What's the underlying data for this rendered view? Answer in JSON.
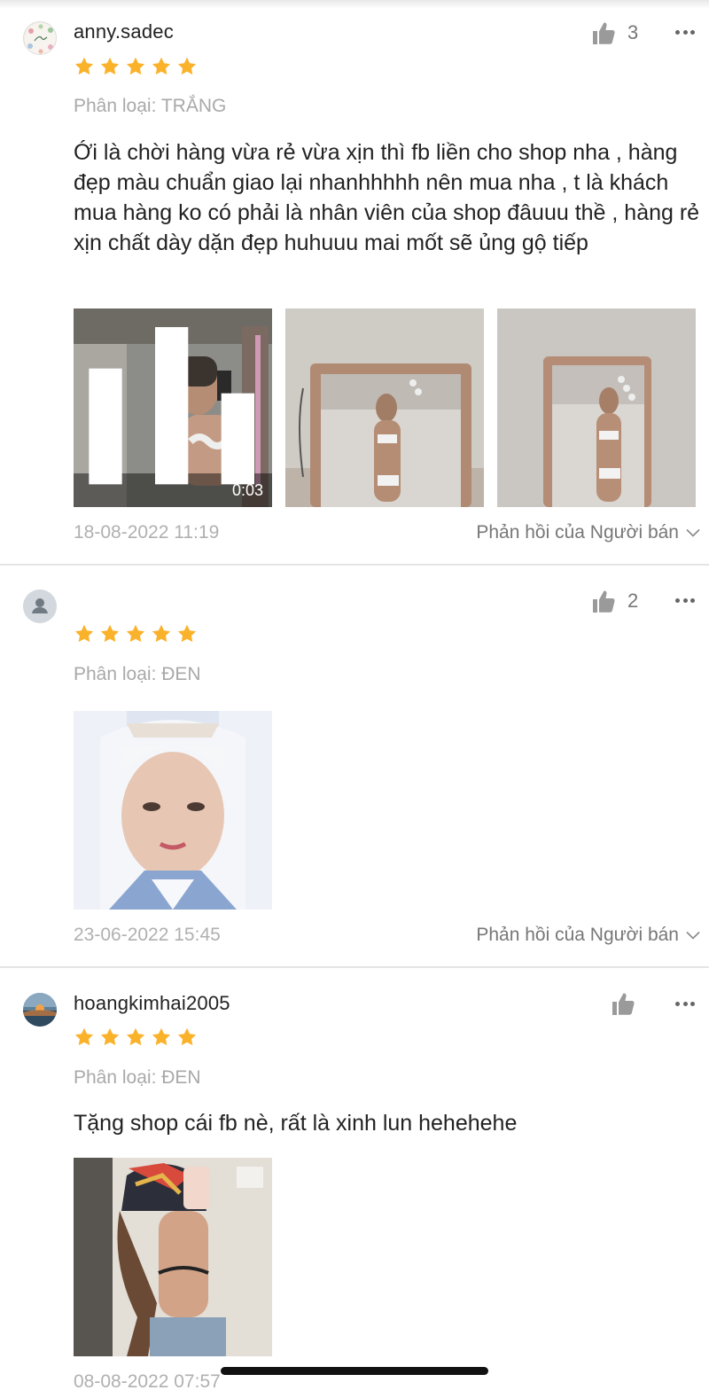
{
  "reviews": [
    {
      "username": "anny.sadec",
      "likes": "3",
      "rating": 5,
      "variation": "Phân loại: TRẮNG",
      "comment": "Ới là chời hàng vừa rẻ vừa xịn thì fb liền cho shop nha , hàng đẹp màu chuẩn giao lại nhanhhhhh nên mua nha , t là khách mua hàng ko có phải là nhân viên của shop đâuuu thề , hàng rẻ xịn chất dày dặn đẹp huhuuu mai mốt sẽ ủng gộ tiếp",
      "video_duration": "0:03",
      "datetime": "18-08-2022 11:19",
      "reply_label": "Phản hồi của Người bán"
    },
    {
      "username": "",
      "likes": "2",
      "rating": 5,
      "variation": "Phân loại: ĐEN",
      "comment": "",
      "datetime": "23-06-2022 15:45",
      "reply_label": "Phản hồi của Người bán"
    },
    {
      "username": "hoangkimhai2005",
      "likes": "",
      "rating": 5,
      "variation": "Phân loại: ĐEN",
      "comment": "Tặng shop cái fb nè, rất là xinh lun hehehehe",
      "datetime": "08-08-2022 07:57",
      "reply_label": ""
    }
  ],
  "colors": {
    "star": "#FBB22B",
    "muted_text": "#A9A9A9",
    "divider": "#E4E4E4"
  },
  "icons": [
    "thumbs-up-icon",
    "more-dots-icon",
    "star-icon",
    "chevron-down-icon",
    "video-bars-icon",
    "default-user-icon"
  ]
}
